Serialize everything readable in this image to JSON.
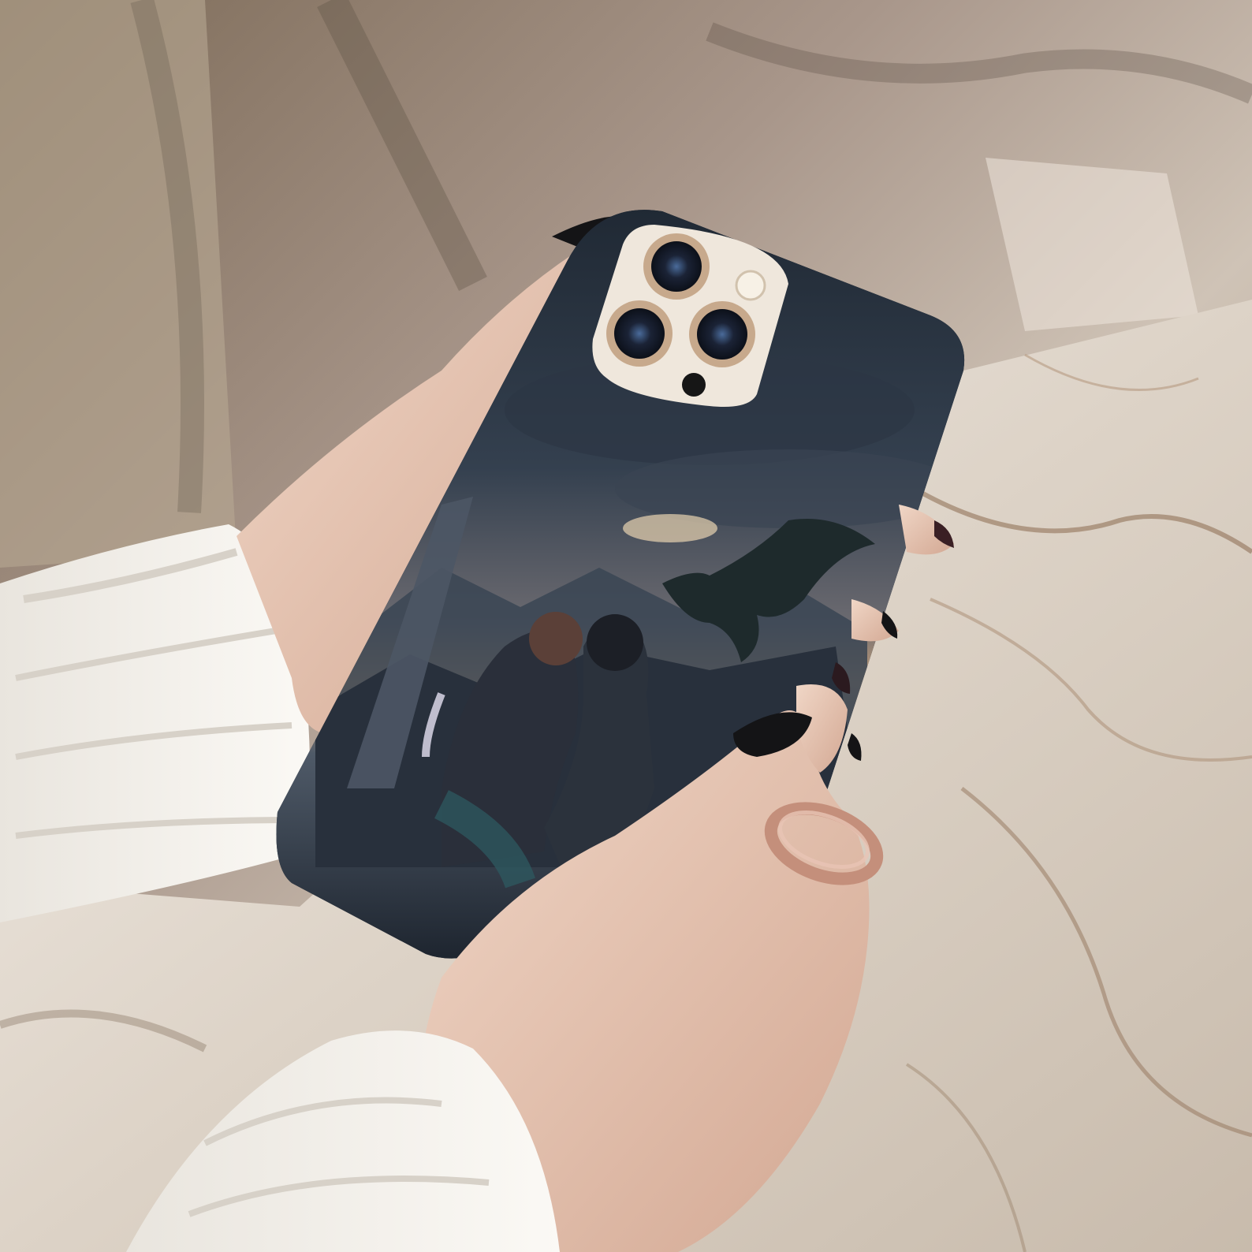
{
  "scene": {
    "subject": "phone-case-photo",
    "colors": {
      "marble_light": "#e9e2d9",
      "marble_mid": "#cfc3b4",
      "marble_vein": "#8b6a4f",
      "wall_shadow": "#6e6253",
      "sleeve": "#f2efe9",
      "skin": "#e8c7b3",
      "skin_shadow": "#c99d86",
      "nail": "#141416",
      "case_dark": "#1d2530",
      "sky_top": "#2a3442",
      "sky_glow": "#c9a27a",
      "camera_bump": "#efe7dc",
      "lens_ring": "#c7a98c",
      "lens_glass": "#1b2336",
      "ring_gold": "#c48f7b"
    }
  }
}
